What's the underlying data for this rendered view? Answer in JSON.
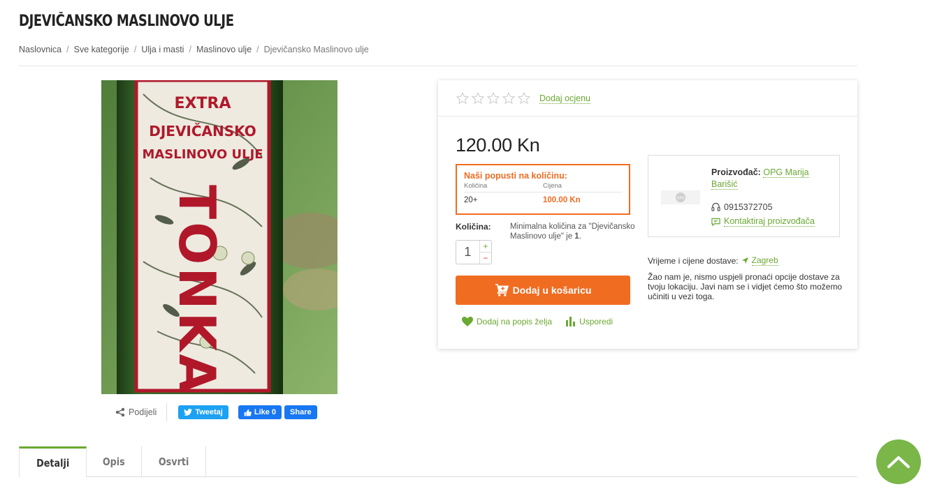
{
  "page": {
    "title": "DJEVIČANSKO MASLINOVO ULJE"
  },
  "breadcrumb": [
    "Naslovnica",
    "Sve kategorije",
    "Ulja i masti",
    "Maslinovo ulje",
    "Djevičansko Maslinovo ulje"
  ],
  "product_image": {
    "label_lines": [
      "EXTRA",
      "DJEVIČANSKO",
      "MASLINOVO ULJE"
    ],
    "brand_vertical": "TONKA"
  },
  "share": {
    "label": "Podijeli",
    "tweet": "Tweetaj",
    "fb_like": "Like 0",
    "fb_share": "Share"
  },
  "rating": {
    "stars": 5,
    "filled": 0,
    "add_label": "Dodaj ocjenu"
  },
  "price": "120.00 Kn",
  "discounts": {
    "title": "Naši popusti na količinu:",
    "col_qty": "Količina",
    "col_price": "Cijena",
    "rows": [
      {
        "qty": "20+",
        "price": "100.00 Kn"
      }
    ]
  },
  "quantity": {
    "label": "Količina:",
    "note_prefix": "Minimalna količina za \"Djevičansko Maslinovo ulje\" je ",
    "note_min": "1",
    "note_suffix": ".",
    "value": "1",
    "plus": "+",
    "minus": "−"
  },
  "cart_button": "Dodaj u košaricu",
  "wishlist": "Dodaj na popis želja",
  "compare": "Usporedi",
  "manufacturer": {
    "label": "Proizvođač:",
    "name": "OPG Marija Barišić",
    "phone": "0915372705",
    "contact": "Kontaktiraj proizvođača"
  },
  "delivery": {
    "label": "Vrijeme i cijene dostave:",
    "city": "Zagreb",
    "note": "Žao nam je, nismo uspjeli pronaći opcije dostave za tvoju lokaciju. Javi nam se i vidjet ćemo što možemo učiniti u vezi toga."
  },
  "tabs": [
    {
      "label": "Detalji",
      "active": true
    },
    {
      "label": "Opis",
      "active": false
    },
    {
      "label": "Osvrti",
      "active": false
    }
  ],
  "colors": {
    "accent_green": "#6aa832",
    "accent_orange": "#f06c21"
  }
}
